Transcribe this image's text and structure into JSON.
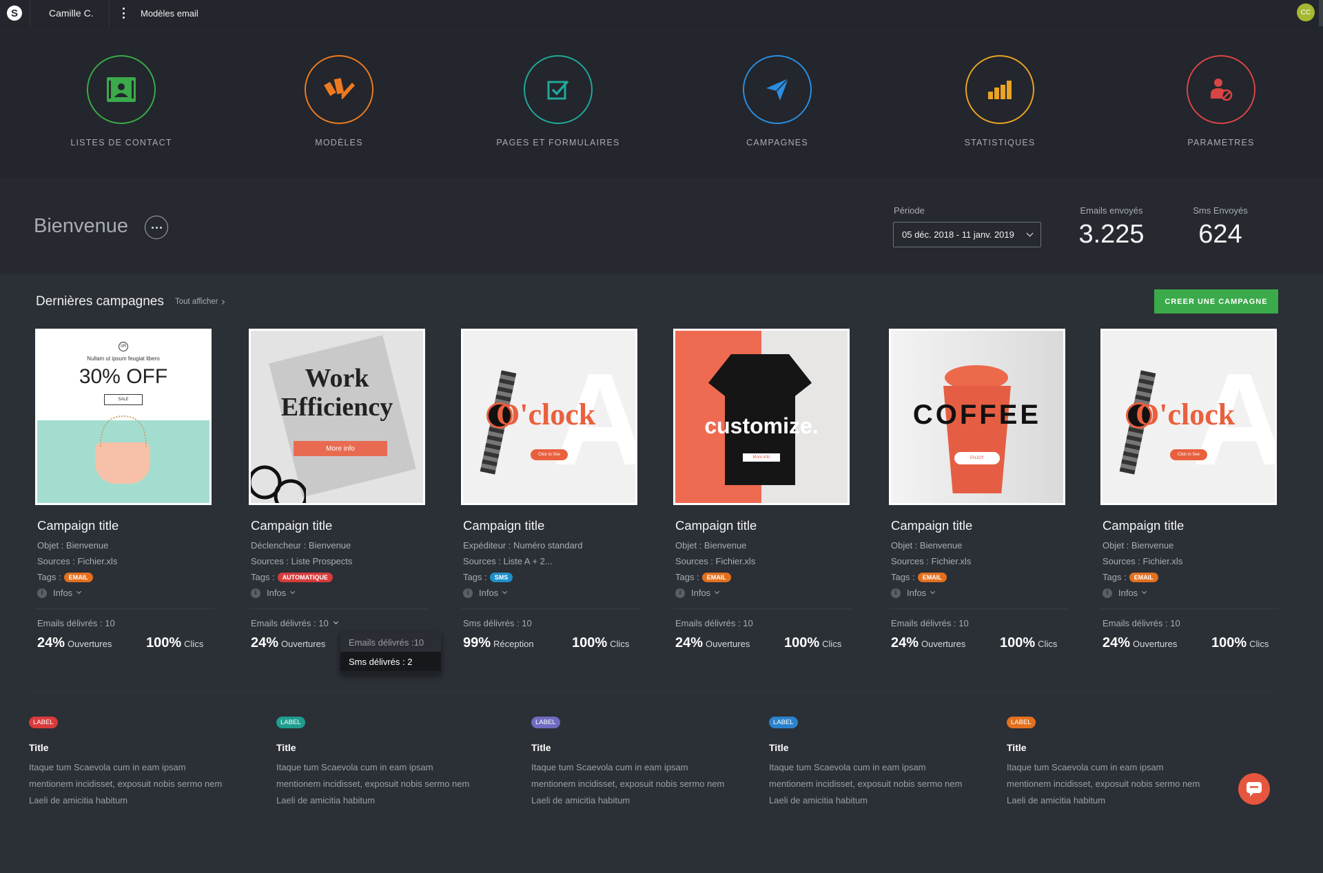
{
  "topbar": {
    "logo_letter": "S",
    "user_name": "Camille C.",
    "page_name": "Modèles email",
    "avatar_initials": "CC"
  },
  "nav": [
    {
      "label": "LISTES DE CONTACT",
      "color": "#3aaa4a",
      "icon": "contact-list-icon"
    },
    {
      "label": "MODÈLES",
      "color": "#ee7a1f",
      "icon": "templates-icon"
    },
    {
      "label": "PAGES ET FORMULAIRES",
      "color": "#20a89b",
      "icon": "forms-icon"
    },
    {
      "label": "CAMPAGNES",
      "color": "#2b8ee0",
      "icon": "campaign-send-icon"
    },
    {
      "label": "STATISTIQUES",
      "color": "#e9a325",
      "icon": "statistics-icon"
    },
    {
      "label": "PARAMETRES",
      "color": "#d94545",
      "icon": "settings-user-icon"
    }
  ],
  "welcome": {
    "title": "Bienvenue",
    "period_label": "Période",
    "period_value": "05 déc. 2018 - 11 janv. 2019",
    "emails_label": "Emails envoyés",
    "emails_value": "3.225",
    "sms_label": "Sms Envoyés",
    "sms_value": "624"
  },
  "campaigns_section": {
    "title": "Dernières campagnes",
    "see_all": "Tout afficher",
    "create_button": "CREER UNE CAMPAGNE"
  },
  "campaigns": [
    {
      "thumb": "sale",
      "thumb_text": [
        "Nullam ut ipsum feugiat libero",
        "30% OFF",
        "SALE"
      ],
      "title": "Campaign title",
      "line1": "Objet : Bienvenue",
      "line2": "Sources : Fichier.xls",
      "tags_label": "Tags :",
      "tag": "EMAIL",
      "tag_color": "#e3701f",
      "infos": "Infos",
      "delivered": "Emails délivrés : 10",
      "m1_value": "24%",
      "m1_label": "Ouvertures",
      "m2_value": "100%",
      "m2_label": "Clics"
    },
    {
      "thumb": "work",
      "thumb_text": [
        "Work",
        "Efficiency",
        "More info"
      ],
      "title": "Campaign title",
      "line1": "Déclencheur : Bienvenue",
      "line2": "Sources : Liste Prospects",
      "tags_label": "Tags :",
      "tag": "AUTOMATIQUE",
      "tag_color": "#d83b3b",
      "infos": "Infos",
      "delivered": "Emails délivrés : 10",
      "m1_value": "24%",
      "m1_label": "Ouvertures",
      "m2_value": "100%",
      "m2_label": "Clics"
    },
    {
      "thumb": "oclock",
      "thumb_text": [
        "O'clock",
        "Click to See"
      ],
      "title": "Campaign title",
      "line1": "Expéditeur : Numéro standard",
      "line2": "Sources : Liste A + 2...",
      "tags_label": "Tags :",
      "tag": "SMS",
      "tag_color": "#1f8fc9",
      "infos": "Infos",
      "delivered": "Sms délivrés : 10",
      "m1_value": "99%",
      "m1_label": "Réception",
      "m2_value": "100%",
      "m2_label": "Clics"
    },
    {
      "thumb": "customize",
      "thumb_text": [
        "customize.",
        "More info"
      ],
      "title": "Campaign title",
      "line1": "Objet : Bienvenue",
      "line2": "Sources : Fichier.xls",
      "tags_label": "Tags :",
      "tag": "EMAIL",
      "tag_color": "#e3701f",
      "infos": "Infos",
      "delivered": "Emails délivrés : 10",
      "m1_value": "24%",
      "m1_label": "Ouvertures",
      "m2_value": "100%",
      "m2_label": "Clics"
    },
    {
      "thumb": "coffee",
      "thumb_text": [
        "COFFEE",
        "ENJOY"
      ],
      "title": "Campaign title",
      "line1": "Objet : Bienvenue",
      "line2": "Sources : Fichier.xls",
      "tags_label": "Tags :",
      "tag": "EMAIL",
      "tag_color": "#e3701f",
      "infos": "Infos",
      "delivered": "Emails délivrés : 10",
      "m1_value": "24%",
      "m1_label": "Ouvertures",
      "m2_value": "100%",
      "m2_label": "Clics"
    },
    {
      "thumb": "oclock",
      "thumb_text": [
        "O'clock",
        "Click to See"
      ],
      "title": "Campaign title",
      "line1": "Objet : Bienvenue",
      "line2": "Sources : Fichier.xls",
      "tags_label": "Tags :",
      "tag": "EMAIL",
      "tag_color": "#e3701f",
      "infos": "Infos",
      "delivered": "Emails délivrés : 10",
      "m1_value": "24%",
      "m1_label": "Ouvertures",
      "m2_value": "100%",
      "m2_label": "Clics"
    }
  ],
  "delivered_dropdown": {
    "items": [
      "Emails délivrés :10",
      "Sms délivrés : 2"
    ]
  },
  "articles": [
    {
      "label": "LABEL",
      "label_color": "#d83b3b",
      "title": "Title",
      "text": "Itaque tum Scaevola cum in eam ipsam mentionem incidisset, exposuit nobis sermo nem Laeli de amicitia habitum"
    },
    {
      "label": "LABEL",
      "label_color": "#1f9e8e",
      "title": "Title",
      "text": "Itaque tum Scaevola cum in eam ipsam mentionem incidisset, exposuit nobis sermo nem Laeli de amicitia habitum"
    },
    {
      "label": "LABEL",
      "label_color": "#6f6bc0",
      "title": "Title",
      "text": "Itaque tum Scaevola cum in eam ipsam mentionem incidisset, exposuit nobis sermo nem Laeli de amicitia habitum"
    },
    {
      "label": "LABEL",
      "label_color": "#2b82cc",
      "title": "Title",
      "text": "Itaque tum Scaevola cum in eam ipsam mentionem incidisset, exposuit nobis sermo nem Laeli de amicitia habitum"
    },
    {
      "label": "LABEL",
      "label_color": "#e3701f",
      "title": "Title",
      "text": "Itaque tum Scaevola cum in eam ipsam mentionem incidisset, exposuit nobis sermo nem Laeli de amicitia habitum"
    }
  ],
  "chat": {
    "icon": "chat-icon"
  }
}
